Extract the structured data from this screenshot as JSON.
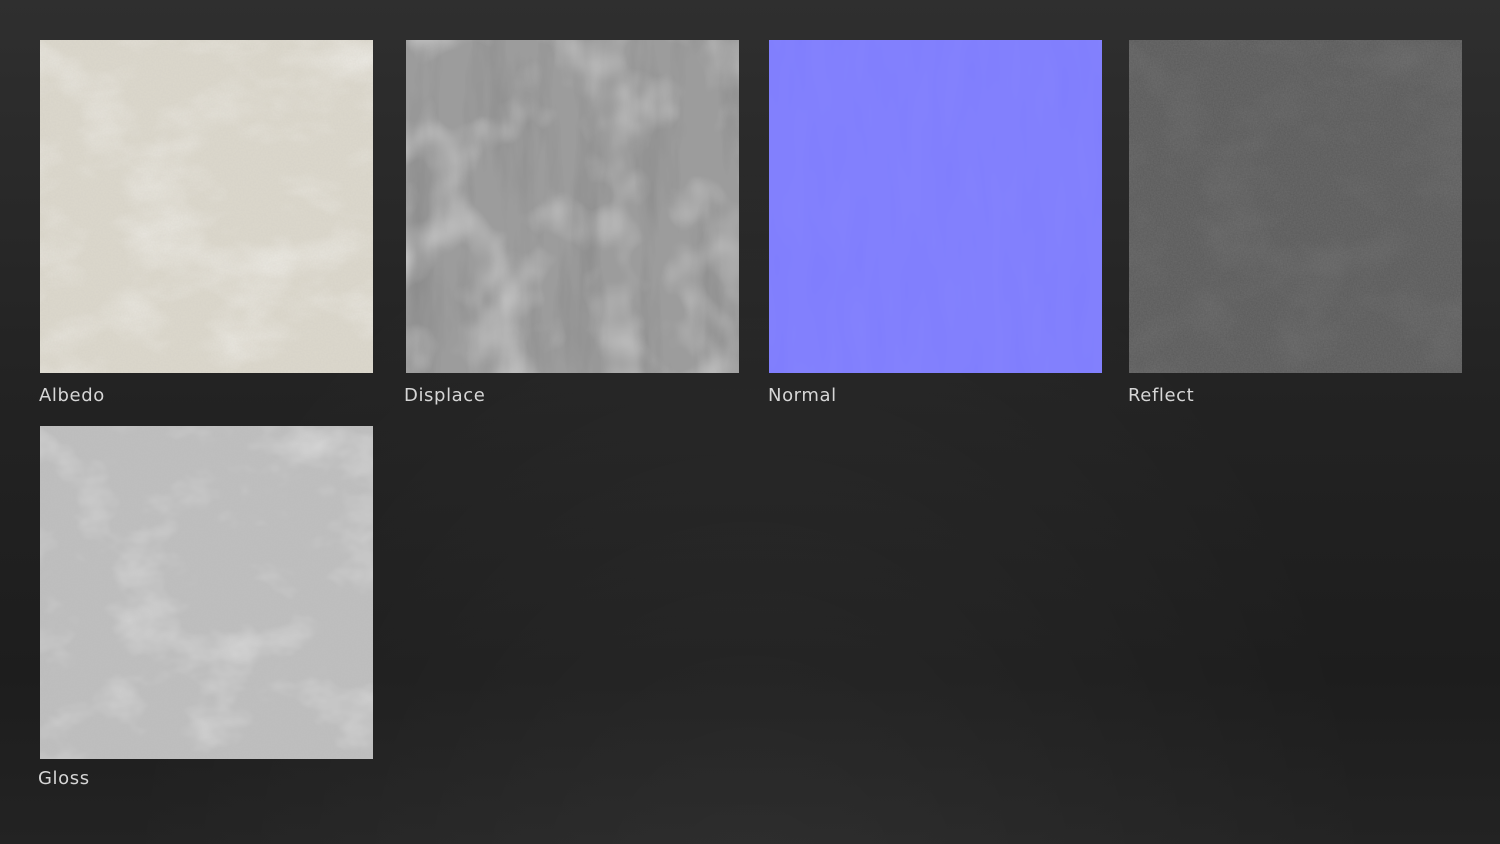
{
  "maps": [
    {
      "label": "Albedo",
      "texture": "albedo",
      "base_color": "#e6e2d8"
    },
    {
      "label": "Displace",
      "texture": "displace",
      "base_color": "#9b9b9b"
    },
    {
      "label": "Normal",
      "texture": "normal",
      "base_color": "#8080ff"
    },
    {
      "label": "Reflect",
      "texture": "reflect",
      "base_color": "#545454"
    },
    {
      "label": "Gloss",
      "texture": "gloss",
      "base_color": "#c6c6c6"
    }
  ]
}
